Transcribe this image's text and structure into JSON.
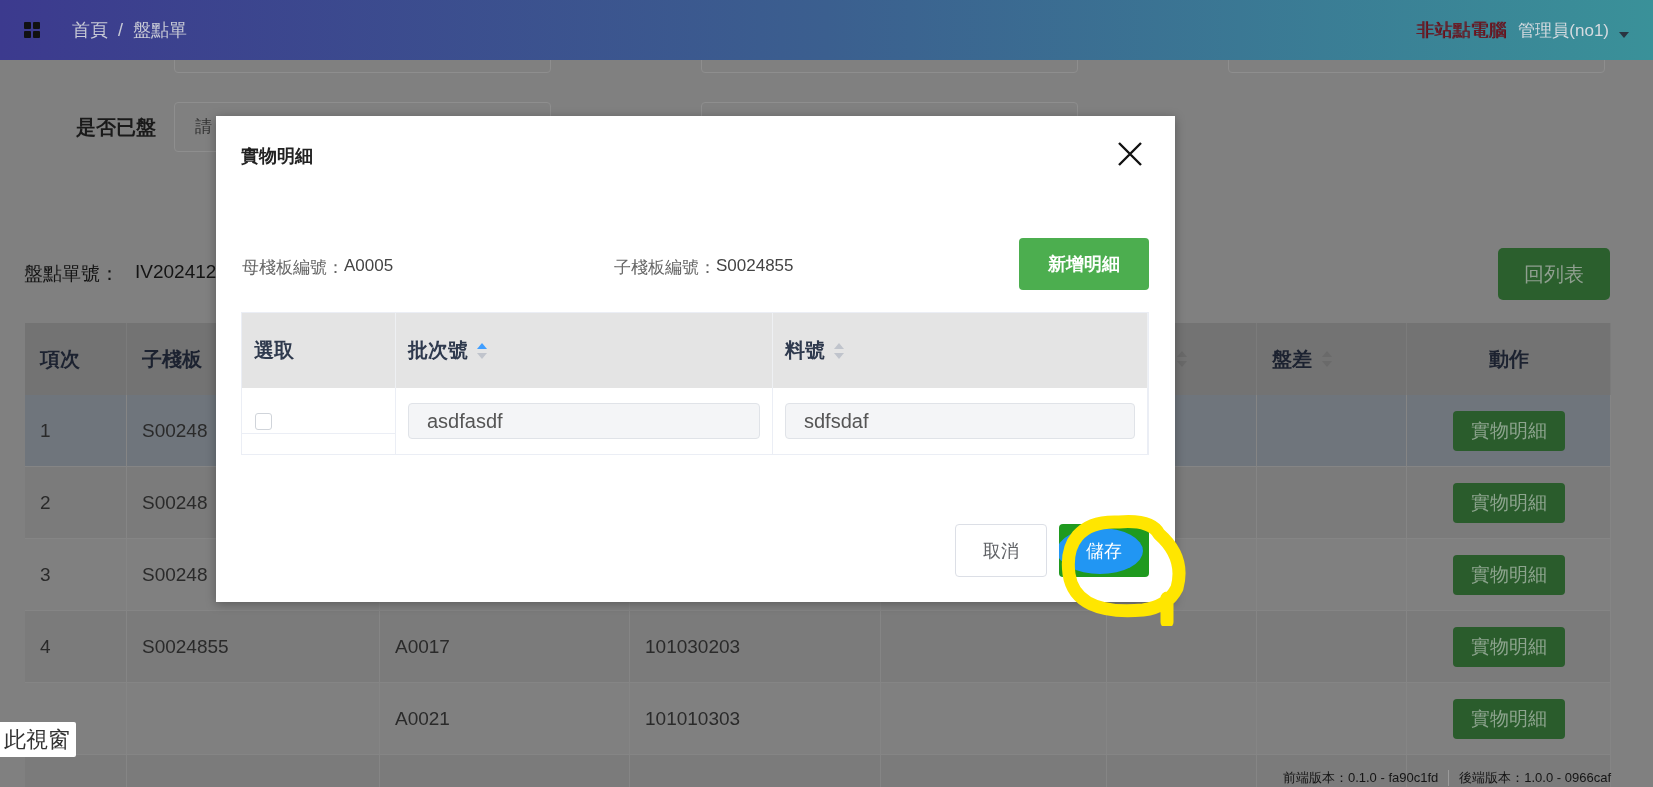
{
  "header": {
    "breadcrumb": [
      "首頁",
      "盤點單"
    ],
    "separator": "/",
    "warning": "非站點電腦",
    "user": "管理員(no1)"
  },
  "filters": {
    "label": "是否已盤",
    "placeholder": "請"
  },
  "order": {
    "label": "盤點單號：",
    "value": "IV202412"
  },
  "back_button": "回列表",
  "table": {
    "columns": [
      {
        "label": "項次"
      },
      {
        "label": "子棧板"
      },
      {},
      {},
      {},
      {
        "sortable": true,
        "ascending": false
      },
      {
        "label": "盤差",
        "sortable": true,
        "ascending": false
      },
      {
        "label": "動作"
      }
    ],
    "rows": [
      {
        "selected": true,
        "cells": [
          "1",
          "S00248"
        ],
        "action": "實物明細"
      },
      {
        "selected": false,
        "cells": [
          "2",
          "S00248"
        ],
        "action": "實物明細"
      },
      {
        "selected": false,
        "cells": [
          "3",
          "S00248"
        ],
        "action": "實物明細"
      },
      {
        "selected": false,
        "cells": [
          "4",
          "S0024855",
          "A0017",
          "101030203"
        ],
        "action": "實物明細"
      },
      {
        "selected": false,
        "cells": [
          null,
          null,
          "A0021",
          "101010303"
        ],
        "action": "實物明細"
      },
      {
        "selected": false,
        "cells": []
      }
    ]
  },
  "modal": {
    "title": "實物明細",
    "info": [
      {
        "label": "母棧板編號：",
        "value": "A0005"
      },
      {
        "label": "子棧板編號：",
        "value": "S0024855"
      }
    ],
    "add_button": "新增明細",
    "table": {
      "columns": [
        {
          "label": "選取"
        },
        {
          "label": "批次號",
          "sortable": true,
          "ascending": true
        },
        {
          "label": "料號",
          "sortable": true,
          "ascending": false
        }
      ],
      "rows": [
        {
          "checked": false,
          "batch": "asdfasdf",
          "part": "sdfsdaf"
        }
      ]
    },
    "buttons": [
      {
        "label": "取消",
        "kind": "default"
      },
      {
        "label": "儲存",
        "kind": "primary"
      }
    ]
  },
  "tooltip": "此視窗",
  "versions": [
    "前端版本：0.1.0 - fa90c1fd",
    "後端版本：1.0.0 - 0966caf"
  ]
}
